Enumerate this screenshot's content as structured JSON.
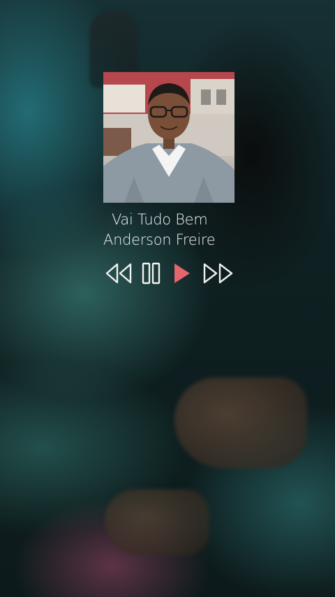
{
  "track": {
    "title": "Vai Tudo Bem",
    "artist": "Anderson Freire"
  },
  "controls": {
    "rewind_icon": "rewind-icon",
    "pause_icon": "pause-icon",
    "play_icon": "play-icon",
    "fast_forward_icon": "fast-forward-icon"
  },
  "colors": {
    "control_stroke": "#f1f1f1",
    "play_accent": "#e5656f",
    "text": "#f3f3f3"
  }
}
